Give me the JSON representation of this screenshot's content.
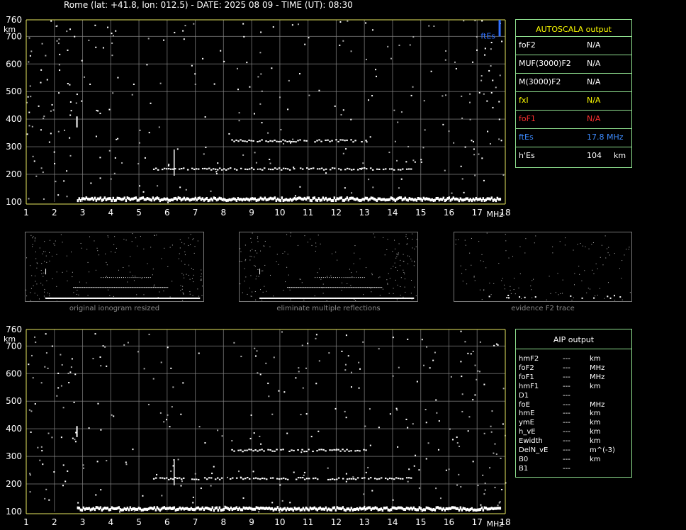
{
  "header": "Rome (lat: +41.8, lon: 012.5) - DATE: 2025 08 09 - TIME (UT): 08:30",
  "colors": {
    "grid": "#888888",
    "axis": "#e8e860",
    "label": "#ffffff",
    "fte": "#3070ff",
    "panel_border": "#8fe08f",
    "yellow": "#ffff00",
    "red": "#ff3030",
    "blue": "#3d8bff"
  },
  "chart_data": [
    {
      "type": "scatter",
      "title": "",
      "xlabel": "MHz",
      "ylabel": "km",
      "xlim": [
        1,
        18
      ],
      "ylim": [
        100,
        760
      ],
      "xticks": [
        "1",
        "2",
        "3",
        "4",
        "5",
        "6",
        "7",
        "8",
        "9",
        "10",
        "11",
        "12",
        "13",
        "14",
        "15",
        "16",
        "17",
        "18"
      ],
      "yticks": [
        "100",
        "200",
        "300",
        "400",
        "500",
        "600",
        "700",
        "760"
      ],
      "grid": true,
      "annotation": "ftEs",
      "traces": [
        {
          "name": "",
          "freq_start": 2.8,
          "freq_end": 17.8,
          "height": 115
        },
        {
          "name": "",
          "freq_start": 5.5,
          "freq_end": 14.7,
          "height": 222
        },
        {
          "name": "",
          "freq_start": 8.2,
          "freq_end": 13.1,
          "height": 324
        }
      ],
      "ftEs_marker": {
        "freq": 17.8,
        "height_from": 700,
        "height_to": 760
      }
    },
    {
      "type": "scatter",
      "title": "",
      "xlabel": "MHz",
      "ylabel": "km",
      "xlim": [
        1,
        18
      ],
      "ylim": [
        100,
        760
      ],
      "xticks": [
        "1",
        "2",
        "3",
        "4",
        "5",
        "6",
        "7",
        "8",
        "9",
        "10",
        "11",
        "12",
        "13",
        "14",
        "15",
        "16",
        "17",
        "18"
      ],
      "yticks": [
        "100",
        "200",
        "300",
        "400",
        "500",
        "600",
        "700",
        "760"
      ],
      "grid": true,
      "traces": [
        {
          "name": "",
          "freq_start": 2.8,
          "freq_end": 17.8,
          "height": 115
        },
        {
          "name": "",
          "freq_start": 5.5,
          "freq_end": 14.7,
          "height": 222
        },
        {
          "name": "",
          "freq_start": 8.2,
          "freq_end": 13.1,
          "height": 324
        }
      ]
    }
  ],
  "autoscala": {
    "title": "AUTOSCALA output",
    "rows": [
      {
        "label": "foF2",
        "value": "N/A",
        "unit": "",
        "color": "#ffffff"
      },
      {
        "label": "MUF(3000)F2",
        "value": "N/A",
        "unit": "",
        "color": "#ffffff"
      },
      {
        "label": "M(3000)F2",
        "value": "N/A",
        "unit": "",
        "color": "#ffffff"
      },
      {
        "label": "fxI",
        "value": "N/A",
        "unit": "",
        "color": "#ffff00"
      },
      {
        "label": "foF1",
        "value": "N/A",
        "unit": "",
        "color": "#ff3030"
      },
      {
        "label": "ftEs",
        "value": "17.8 MHz",
        "unit": "",
        "color": "#3d8bff"
      },
      {
        "label": "h'Es",
        "value": "104",
        "unit": "km",
        "color": "#ffffff"
      }
    ]
  },
  "thumbnails": [
    {
      "caption": "original ionogram resized"
    },
    {
      "caption": "eliminate multiple reflections"
    },
    {
      "caption": "evidence F2 trace"
    }
  ],
  "aip": {
    "title": "AIP output",
    "rows": [
      {
        "label": "hmF2",
        "value": "---",
        "unit": "km"
      },
      {
        "label": "foF2",
        "value": "---",
        "unit": "MHz"
      },
      {
        "label": "foF1",
        "value": "---",
        "unit": "MHz"
      },
      {
        "label": "hmF1",
        "value": "---",
        "unit": "km"
      },
      {
        "label": "D1",
        "value": "---",
        "unit": ""
      },
      {
        "label": "foE",
        "value": "---",
        "unit": "MHz"
      },
      {
        "label": "hmE",
        "value": "---",
        "unit": "km"
      },
      {
        "label": "ymE",
        "value": "---",
        "unit": "km"
      },
      {
        "label": "h_vE",
        "value": "---",
        "unit": "km"
      },
      {
        "label": "Ewidth",
        "value": "---",
        "unit": "km"
      },
      {
        "label": "DelN_vE",
        "value": "---",
        "unit": "m^(-3)"
      },
      {
        "label": "B0",
        "value": "---",
        "unit": "km"
      },
      {
        "label": "B1",
        "value": "---",
        "unit": ""
      }
    ]
  }
}
